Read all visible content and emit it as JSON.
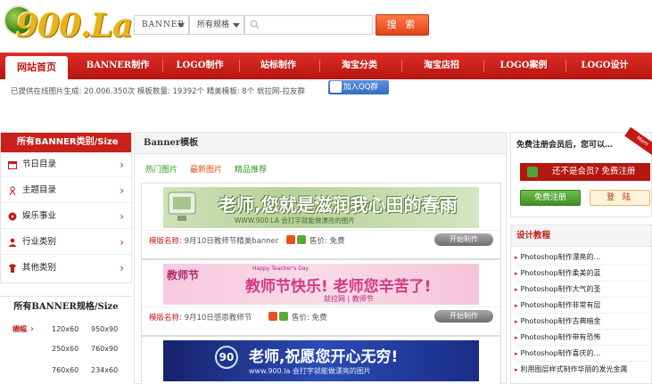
{
  "logo": {
    "text": "900.La"
  },
  "search": {
    "type_select": "BANNER",
    "size_select": "所有规格",
    "input_value": "",
    "button": "搜 索"
  },
  "nav": {
    "home": "网站首页",
    "items": [
      "BANNER制作",
      "LOGO制作",
      "站标制作",
      "淘宝分类",
      "淘宝店招",
      "LOGO案例",
      "LOGO设计"
    ]
  },
  "stats": {
    "text": "已提供在线图片生成: 20.006.350次  模板数量: 19392个  精美模板: 8个  就拉网-拉友群",
    "qq_button": "加入QQ群"
  },
  "sidebar": {
    "categories_title": "所有BANNER类别/Size",
    "categories": [
      {
        "label": "节日目录",
        "icon": "calendar-icon",
        "icon_color": "#c41a14"
      },
      {
        "label": "主题目录",
        "icon": "theme-icon",
        "icon_color": "#c41a14"
      },
      {
        "label": "娱乐事业",
        "icon": "entertainment-icon",
        "icon_color": "#c41a14"
      },
      {
        "label": "行业类别",
        "icon": "user-icon",
        "icon_color": "#c41a14"
      },
      {
        "label": "其他类别",
        "icon": "shirt-icon",
        "icon_color": "#c41a14"
      }
    ],
    "sizes_title": "所有BANNER规格/Size",
    "size_label": "横幅",
    "sizes": [
      [
        "120x60",
        "950x90"
      ],
      [
        "250x60",
        "760x90"
      ],
      [
        "760x60",
        "234x60"
      ]
    ]
  },
  "center": {
    "title": "Banner模板",
    "tabs": [
      "热门图片",
      "最新图片",
      "精品推荐"
    ],
    "cards": [
      {
        "banner_text": "老师,您就是滋润我心田的春雨",
        "banner_sub": "WWW.900.LA 会打字就能做漂亮的图片",
        "name_label": "模版名称:",
        "name_value": "9月10日教师节精美banner",
        "price_label": "售价:",
        "price_value": "免费",
        "start_button": "开始制作"
      },
      {
        "banner_text": "教师节快乐! 老师您辛苦了!",
        "banner_sub": "就拉网 | 教师节",
        "banner_side": "教师节",
        "banner_tag": "Happy Teacher's Day",
        "name_label": "模版名称:",
        "name_value": "9月10日感恩教师节",
        "price_label": "售价:",
        "price_value": "免费",
        "start_button": "开始制作"
      },
      {
        "banner_text": "老师,祝愿您开心无穷!",
        "banner_sub": "www.900.la 会打字就能做漂亮的图片",
        "banner_badge": "90",
        "name_label": "",
        "name_value": "",
        "price_label": "",
        "price_value": "",
        "start_button": ""
      }
    ]
  },
  "right": {
    "welcome": "免费注册会员后，您可以…",
    "ribbon": "Mem",
    "not_member_button": "还不是会员? 免费注册",
    "register_button": "免费注册",
    "login_button": "登 陆",
    "tutorial_title": "设计教程",
    "tutorials": [
      "Photoshop制作漂亮的...",
      "Photoshop制作柔美的蓝",
      "Photoshop制作大气的圣",
      "Photoshop制作非常有层",
      "Photoshop制作古典暗金",
      "Photoshop制作带有恐怖",
      "Photoshop制作喜庆的...",
      "利用图层样式制作华丽的发光金属"
    ]
  },
  "colors": {
    "brand_red": "#c41a14",
    "nav_red": "#c9201a",
    "search_orange": "#e85a2a"
  }
}
